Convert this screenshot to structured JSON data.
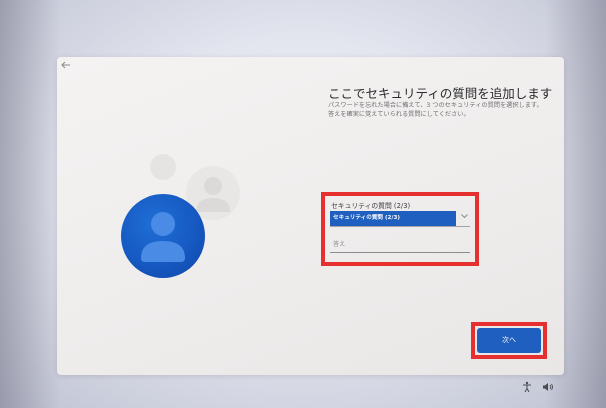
{
  "page": {
    "title": "ここでセキュリティの質問を追加します",
    "description": "パスワードを忘れた場合に備えて、3 つのセキュリティの質問を選択します。答えを確実に覚えていられる質問にしてください。"
  },
  "form": {
    "question_label": "セキュリティの質問 (2/3)",
    "question_selected": "セキュリティの質問 (2/3)",
    "answer_placeholder": "答え",
    "answer_value": ""
  },
  "buttons": {
    "next_label": "次へ"
  },
  "icons": {
    "back": "back-arrow-icon",
    "avatar": "user-avatar-icon",
    "accessibility": "accessibility-icon",
    "volume": "volume-icon",
    "dropdown": "chevron-down-icon"
  },
  "colors": {
    "accent": "#1f5fbf",
    "highlight": "#e5302f",
    "card": "#f2f0ef"
  }
}
